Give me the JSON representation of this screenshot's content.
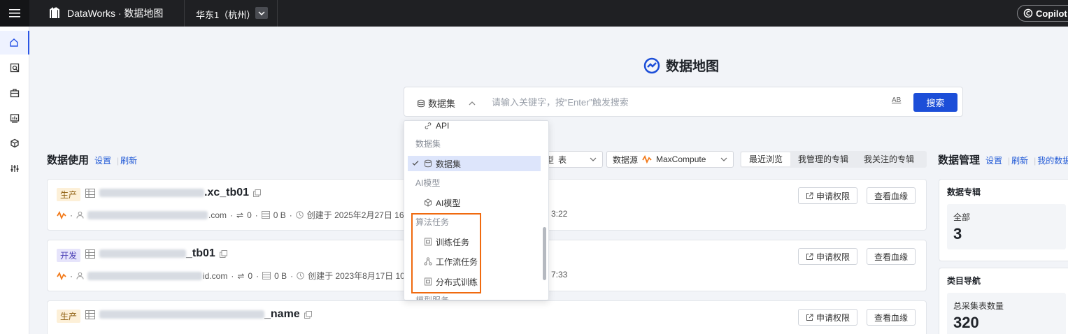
{
  "topbar": {
    "app_title": "DataWorks · 数据地图",
    "region": "华东1（杭州）",
    "copilot": "Copilot"
  },
  "hero": {
    "title": "数据地图",
    "search_type": "数据集",
    "search_placeholder": "请输入关键字，按“Enter”触发搜索",
    "ab_label": "AB",
    "search_button": "搜索"
  },
  "data_usage": {
    "title": "数据使用",
    "settings": "设置",
    "refresh": "刷新"
  },
  "filters": {
    "type_label": "型",
    "type_value": "表",
    "source_label": "数据源",
    "source_value": "MaxCompute"
  },
  "tabs": [
    "最近浏览",
    "我管理的专辑",
    "我关注的专辑"
  ],
  "cards": [
    {
      "env": "生产",
      "name_suffix": ".xc_tb01",
      "email_suffix": ".com",
      "lineage": "0",
      "size": "0 B",
      "created": "创建于 2025年2月27日 16:",
      "time_tail": "3:22"
    },
    {
      "env": "开发",
      "name_suffix": "_tb01",
      "email_suffix": "id.com",
      "lineage": "0",
      "size": "0 B",
      "created": "创建于 2023年8月17日 10:",
      "time_tail": "7:33"
    },
    {
      "env": "生产",
      "name_suffix": "_name"
    }
  ],
  "card_buttons": {
    "apply": "申请权限",
    "lineage": "查看血缘"
  },
  "data_mgmt": {
    "title": "数据管理",
    "settings": "设置",
    "refresh": "刷新",
    "mine": "我的数据"
  },
  "albums": {
    "title": "数据专辑",
    "label": "全部",
    "value": "3"
  },
  "category": {
    "title": "类目导航",
    "label": "总采集表数量",
    "value": "320"
  },
  "dropdown": {
    "api": "API",
    "group_dataset": "数据集",
    "opt_dataset": "数据集",
    "group_ai": "AI模型",
    "opt_ai": "AI模型",
    "group_algo": "算法任务",
    "opt_train": "训练任务",
    "opt_workflow": "工作流任务",
    "opt_distributed": "分布式训练",
    "group_model": "模型服务"
  },
  "colors": {
    "primary": "#1c4ed8",
    "highlight": "#f06a0f",
    "topbar": "#1f2023"
  }
}
